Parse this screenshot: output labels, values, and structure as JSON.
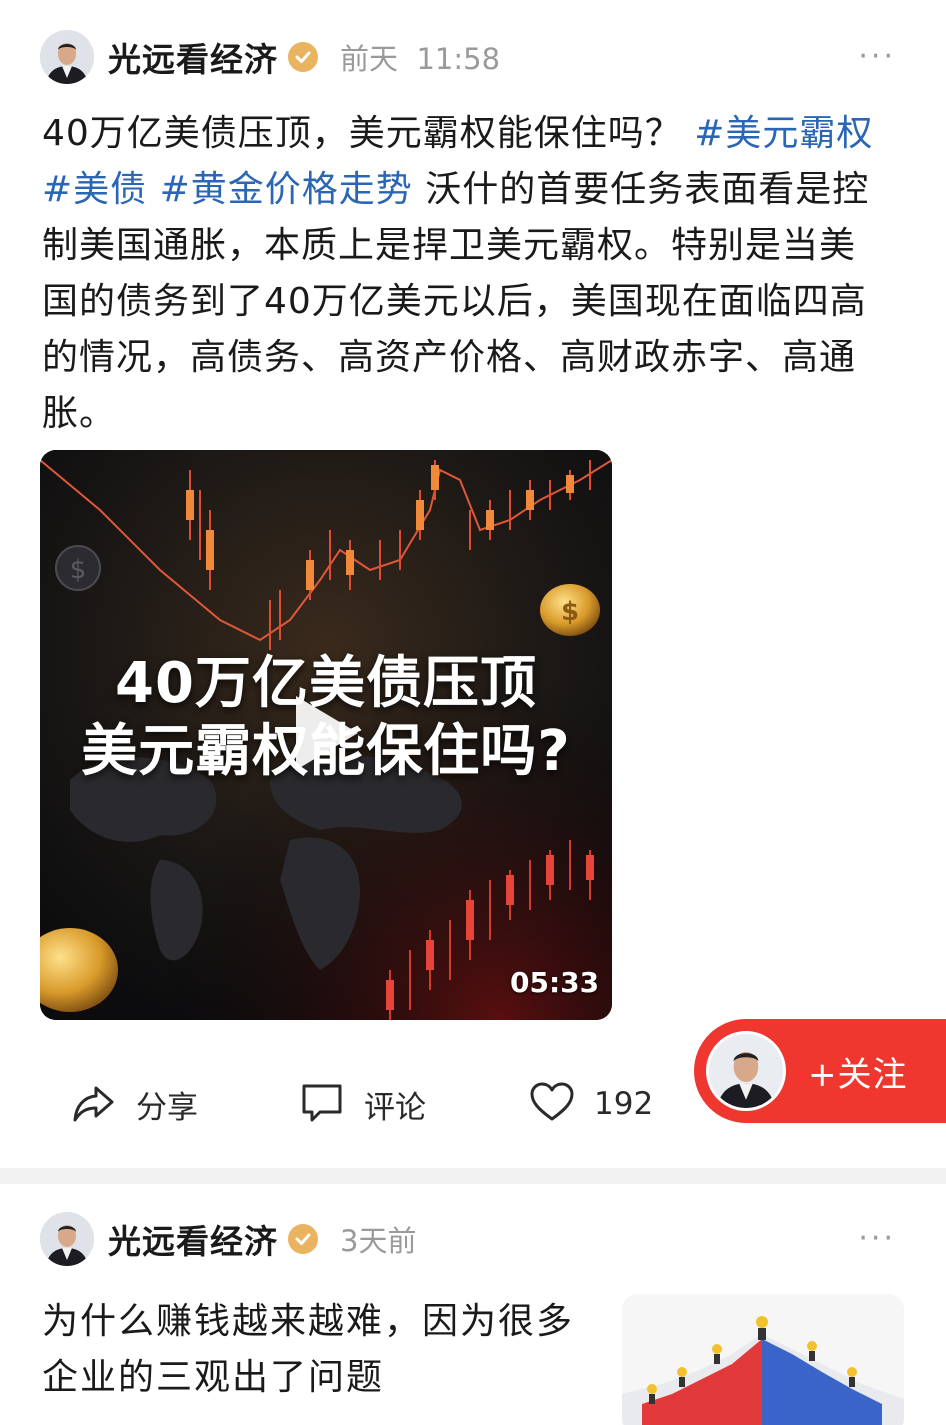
{
  "post1": {
    "author": "光远看经济",
    "time_day": "前天",
    "time_clock": "11:58",
    "more": "···",
    "text_intro": "40万亿美债压顶，美元霸权能保住吗？",
    "hashtags": [
      "#美元霸权",
      "#美债",
      "#黄金价格走势"
    ],
    "text_body": "沃什的首要任务表面看是控制美国通胀，本质上是捍卫美元霸权。特别是当美国的债务到了40万亿美元以后，美国现在面临四高的情况，高债务、高资产价格、高财政赤字、高通胀。",
    "video": {
      "title_line1": "40万亿美债压顶",
      "title_line2": "美元霸权能保住吗?",
      "duration": "05:33"
    },
    "actions": {
      "share_label": "分享",
      "comment_label": "评论",
      "like_count": "192"
    },
    "follow_label": "+关注"
  },
  "post2": {
    "author": "光远看经济",
    "time": "3天前",
    "more": "···",
    "title": "为什么赚钱越来越难，因为很多企业的三观出了问题"
  },
  "colors": {
    "hashtag": "#2a66b3",
    "follow_bg": "#f0372f",
    "verified_badge": "#e9b35f",
    "meta_text": "#9a9a9a"
  },
  "icons": [
    "verified-icon",
    "share-icon",
    "comment-icon",
    "like-icon",
    "play-icon"
  ]
}
